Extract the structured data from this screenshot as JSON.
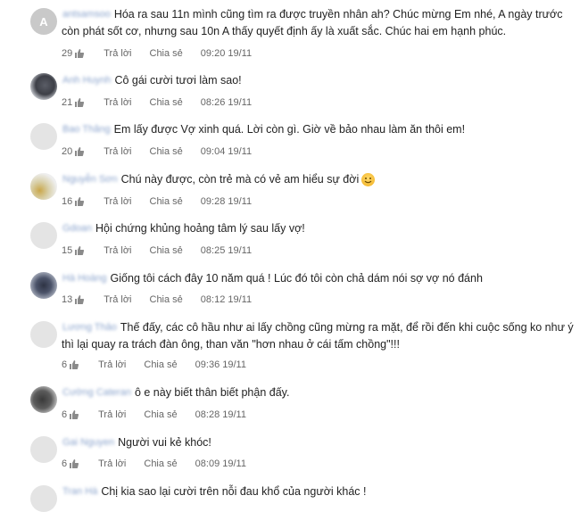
{
  "comments": [
    {
      "avatar": "A",
      "username": "antsamsoo",
      "text_lines": [
        "Hóa ra sau 11n mình cũng tìm ra được truyền nhân ah? Chúc mừng Em nhé, A ngày trước",
        "còn phát sốt cơ, nhưng sau 10n A thấy quyết định ấy là xuất sắc. Chúc hai em hạnh phúc."
      ],
      "likes": "29",
      "reply": "Trả lời",
      "share": "Chia sẻ",
      "time": "09:20 19/11"
    },
    {
      "avatar": "",
      "username": "Anh Huynh",
      "text_lines": [
        "Cô gái cười tươi làm sao!"
      ],
      "likes": "21",
      "reply": "Trả lời",
      "share": "Chia sẻ",
      "time": "08:26 19/11"
    },
    {
      "avatar": "",
      "username": "Bao Thăng",
      "text_lines": [
        "Em lấy được Vợ xinh quá. Lời còn gì. Giờ về bảo nhau làm ăn thôi em!"
      ],
      "likes": "20",
      "reply": "Trả lời",
      "share": "Chia sẻ",
      "time": "09:04 19/11"
    },
    {
      "avatar": "",
      "username": "Nguyễn Sơn",
      "text_lines": [
        "Chú này được, còn trẻ mà có vẻ am hiểu sự đời"
      ],
      "likes": "16",
      "reply": "Trả lời",
      "share": "Chia sẻ",
      "time": "09:28 19/11"
    },
    {
      "avatar": "",
      "username": "Gdoan",
      "text_lines": [
        "Hội chứng khủng hoảng tâm lý sau lấy vợ!"
      ],
      "likes": "15",
      "reply": "Trả lời",
      "share": "Chia sẻ",
      "time": "08:25 19/11"
    },
    {
      "avatar": "",
      "username": "Hà Hoàng",
      "text_lines": [
        "Giống tôi cách đây 10 năm quá ! Lúc đó tôi còn chả dám nói sợ vợ nó đánh"
      ],
      "likes": "13",
      "reply": "Trả lời",
      "share": "Chia sẻ",
      "time": "08:12 19/11"
    },
    {
      "avatar": "",
      "username": "Lương Thảo",
      "text_lines": [
        "Thế đấy, các cô hầu như ai lấy chồng cũng mừng ra mặt, để rồi đến khi cuộc sống ko như ý",
        "thì lại quay ra trách đàn ông, than văn \"hơn nhau ở cái tấm chồng\"!!!"
      ],
      "likes": "6",
      "reply": "Trả lời",
      "share": "Chia sẻ",
      "time": "09:36 19/11"
    },
    {
      "avatar": "",
      "username": "Cường Cateran",
      "text_lines": [
        "ô e này biết thân biết phận đấy."
      ],
      "likes": "6",
      "reply": "Trả lời",
      "share": "Chia sẻ",
      "time": "08:28 19/11"
    },
    {
      "avatar": "",
      "username": "Gai Nguyen",
      "text_lines": [
        "Người vui kẻ khóc!"
      ],
      "likes": "6",
      "reply": "Trả lời",
      "share": "Chia sẻ",
      "time": "08:09 19/11"
    },
    {
      "avatar": "",
      "username": "Tran Hà",
      "text_lines": [
        "Chị kia sao lại cười trên nỗi đau khổ của người khác !"
      ]
    }
  ],
  "icons": {
    "like": "thumbs-up-icon",
    "emoji": "smiling-face-emoji",
    "avatar": "user-avatar"
  }
}
